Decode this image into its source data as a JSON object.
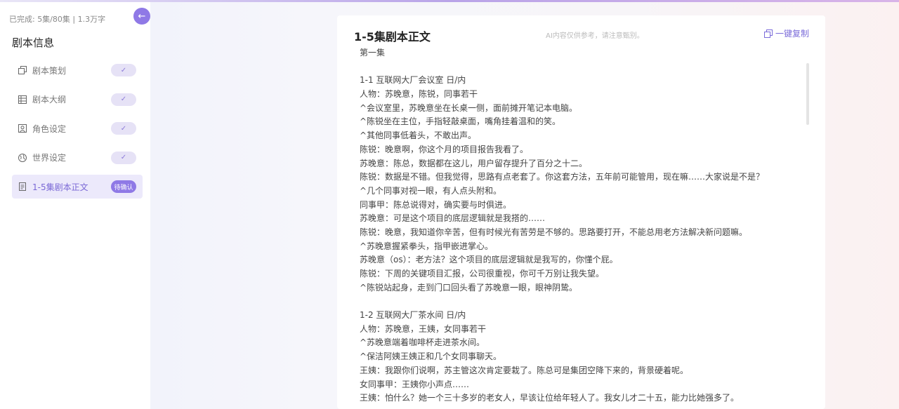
{
  "sidebar": {
    "progress": "已完成: 5集/80集 | 1.3万字",
    "collapse_icon": "arrow-left",
    "title": "剧本信息",
    "items": [
      {
        "label": "剧本策划",
        "icon": "copy-icon",
        "badge": "✓",
        "active": false
      },
      {
        "label": "剧本大纲",
        "icon": "outline-icon",
        "badge": "✓",
        "active": false
      },
      {
        "label": "角色设定",
        "icon": "portrait-icon",
        "badge": "✓",
        "active": false
      },
      {
        "label": "世界设定",
        "icon": "globe-icon",
        "badge": "✓",
        "active": false
      },
      {
        "label": "1-5集剧本正文",
        "icon": "document-icon",
        "badge": "待确认",
        "active": true
      }
    ]
  },
  "panel": {
    "title": "1-5集剧本正文",
    "hint": "AI内容仅供参考，请注意甄别。",
    "copy_label": "一键复制",
    "lines": [
      "第一集",
      "",
      "1-1 互联网大厂会议室 日/内",
      "人物：苏晚意，陈锐，同事若干",
      "^会议室里，苏晚意坐在长桌一侧，面前摊开笔记本电脑。",
      "^陈锐坐在主位，手指轻敲桌面，嘴角挂着温和的笑。",
      "^其他同事低着头，不敢出声。",
      "陈锐：晚意啊，你这个月的项目报告我看了。",
      "苏晚意：陈总，数据都在这儿，用户留存提升了百分之十二。",
      "陈锐：数据是不错。但我觉得，思路有点老套了。你这套方法，五年前可能管用，现在嘛……大家说是不是？",
      "^几个同事对视一眼，有人点头附和。",
      "同事甲：陈总说得对，确实要与时俱进。",
      "苏晚意：可是这个项目的底层逻辑就是我搭的……",
      "陈锐：晚意，我知道你辛苦，但有时候光有苦劳是不够的。思路要打开，不能总用老方法解决新问题嘛。",
      "^苏晚意握紧拳头，指甲嵌进掌心。",
      "苏晚意（os）：老方法？这个项目的底层逻辑就是我写的，你懂个屁。",
      "陈锐：下周的关键项目汇报，公司很重视，你可千万别让我失望。",
      "^陈锐站起身，走到门口回头看了苏晚意一眼，眼神阴鸷。",
      "",
      "1-2 互联网大厂茶水间 日/内",
      "人物：苏晚意，王姨，女同事若干",
      "^苏晚意端着咖啡杯走进茶水间。",
      "^保洁阿姨王姨正和几个女同事聊天。",
      "王姨：我跟你们说啊，苏主管这次肯定要栽了。陈总可是集团空降下来的，背景硬着呢。",
      "女同事甲：王姨你小声点……",
      "王姨：怕什么？她一个三十多岁的老女人，早该让位给年轻人了。我女儿才二十五，能力比她强多了。"
    ]
  }
}
